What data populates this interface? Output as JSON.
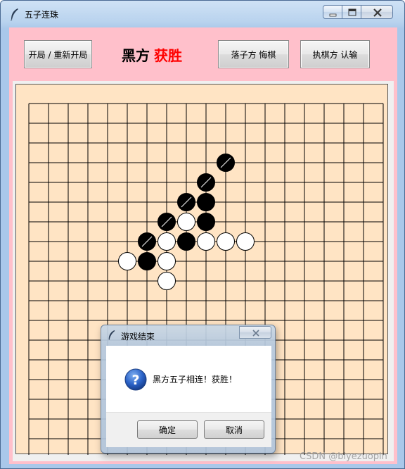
{
  "window": {
    "title": "五子连珠"
  },
  "toolbar": {
    "start_label": "开局 / 重新开局",
    "undo_label": "落子方 悔棋",
    "resign_label": "执棋方 认输"
  },
  "status": {
    "player": "黑方",
    "result": "获胜",
    "player_color": "#000000",
    "result_color": "#ff0000"
  },
  "board": {
    "size": 18,
    "background": "#ffe4c4",
    "last_move_marker": "slash",
    "stones": [
      {
        "col": 10,
        "row": 3,
        "color": "black",
        "marked": true
      },
      {
        "col": 9,
        "row": 4,
        "color": "black",
        "marked": true
      },
      {
        "col": 8,
        "row": 5,
        "color": "black",
        "marked": true
      },
      {
        "col": 9,
        "row": 5,
        "color": "black",
        "marked": false
      },
      {
        "col": 7,
        "row": 6,
        "color": "black",
        "marked": true
      },
      {
        "col": 8,
        "row": 6,
        "color": "white",
        "marked": false
      },
      {
        "col": 9,
        "row": 6,
        "color": "black",
        "marked": false
      },
      {
        "col": 6,
        "row": 7,
        "color": "black",
        "marked": true
      },
      {
        "col": 7,
        "row": 7,
        "color": "white",
        "marked": false
      },
      {
        "col": 8,
        "row": 7,
        "color": "black",
        "marked": false
      },
      {
        "col": 9,
        "row": 7,
        "color": "white",
        "marked": false
      },
      {
        "col": 10,
        "row": 7,
        "color": "white",
        "marked": false
      },
      {
        "col": 11,
        "row": 7,
        "color": "white",
        "marked": false
      },
      {
        "col": 5,
        "row": 8,
        "color": "white",
        "marked": false
      },
      {
        "col": 6,
        "row": 8,
        "color": "black",
        "marked": false
      },
      {
        "col": 7,
        "row": 8,
        "color": "white",
        "marked": false
      },
      {
        "col": 7,
        "row": 9,
        "color": "white",
        "marked": false
      }
    ]
  },
  "dialog": {
    "title": "游戏结束",
    "message": "黑方五子相连！获胜！",
    "icon": "question-icon",
    "ok_label": "确定",
    "cancel_label": "取消"
  },
  "watermark": "CSDN @biyezuopin"
}
